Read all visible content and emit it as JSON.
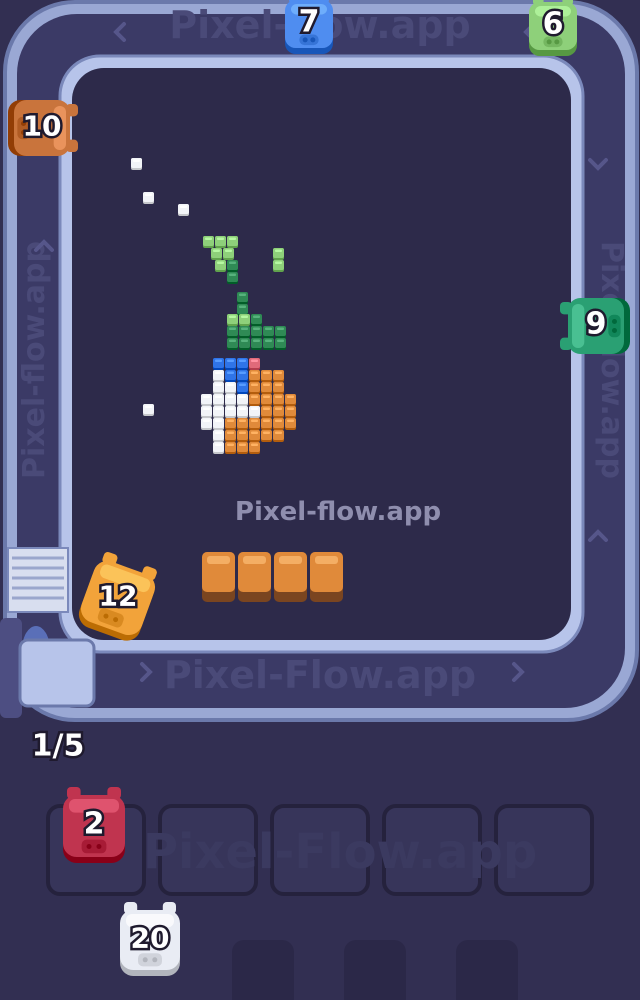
{
  "watermark": {
    "center": "Pixel-flow.app",
    "belt_top": "Pixel-flow.app",
    "belt_bottom": "Pixel-Flow.app",
    "belt_left": "Pixel-flow.app",
    "belt_right": "Pixel-flow.app",
    "slots": "Pixel-Flow.app"
  },
  "counter": {
    "label": "1/5"
  },
  "belt_shooters": [
    {
      "name": "belt-shooter-blue",
      "value": "7",
      "color": "#4f8df0"
    },
    {
      "name": "belt-shooter-light-green",
      "value": "6",
      "color": "#8ed07a"
    },
    {
      "name": "belt-shooter-brown",
      "value": "10",
      "color": "#c9743c"
    },
    {
      "name": "belt-shooter-green",
      "value": "9",
      "color": "#2aa073"
    },
    {
      "name": "belt-shooter-orange",
      "value": "12",
      "color": "#f2a33a"
    }
  ],
  "queue_shooters": [
    {
      "name": "queue-shooter-red",
      "value": "2",
      "color": "#c0344f"
    },
    {
      "name": "queue-shooter-white",
      "value": "20",
      "color": "#e9ecf4"
    }
  ],
  "queue_slots_count": 5,
  "colors": {
    "background": "#322f52",
    "board": "#2d2a4a",
    "belt": "#a8b6de",
    "belt_edge": "#6876a8",
    "white": "#f2f4f8",
    "light_green": "#8ed07a",
    "dark_green": "#2f8a55",
    "blue": "#2f74e8",
    "orange": "#e08a3a",
    "pink": "#e06a7a"
  }
}
